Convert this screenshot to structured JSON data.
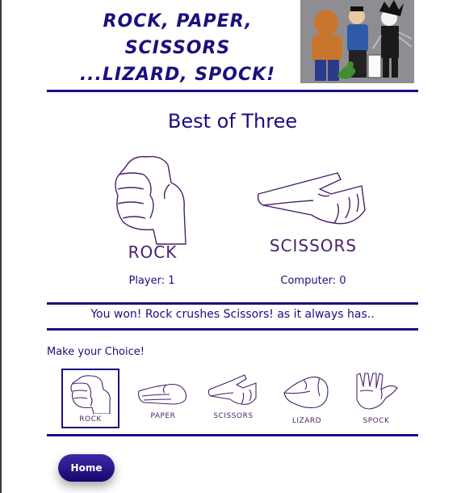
{
  "header": {
    "title_line1": "Rock, Paper, Scissors",
    "title_line2": "...Lizard, Spock!"
  },
  "game": {
    "mode_title": "Best of Three",
    "player": {
      "hand": "ROCK",
      "score_text": "Player: 1"
    },
    "computer": {
      "hand": "SCISSORS",
      "score_text": "Computer: 0"
    },
    "result_message": "You won! Rock crushes Scissors! as it always has.."
  },
  "choices": {
    "label": "Make your Choice!",
    "items": [
      {
        "label": "ROCK",
        "selected": true
      },
      {
        "label": "PAPER",
        "selected": false
      },
      {
        "label": "SCISSORS",
        "selected": false
      },
      {
        "label": "LIZARD",
        "selected": false
      },
      {
        "label": "SPOCK",
        "selected": false
      }
    ]
  },
  "nav": {
    "home_label": "Home"
  },
  "colors": {
    "primary": "#1a0f80",
    "hand_ink": "#4a1f6b"
  }
}
